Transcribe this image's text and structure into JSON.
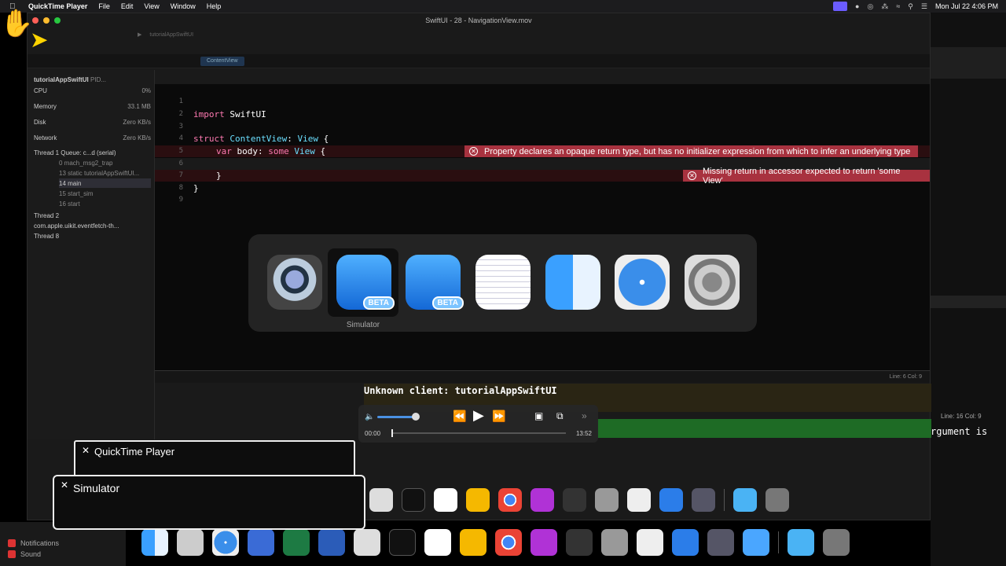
{
  "menubar": {
    "app": "QuickTime Player",
    "items": [
      "File",
      "Edit",
      "View",
      "Window",
      "Help"
    ],
    "clock": "Mon Jul 22  4:06 PM"
  },
  "window": {
    "title": "SwiftUI - 28 - NavigationView.mov",
    "scheme": "tutorialAppSwiftUI",
    "tab": "ContentView"
  },
  "navigator": {
    "process": "tutorialAppSwiftUI",
    "process_suffix": "PID...",
    "gauges": [
      {
        "label": "CPU",
        "value": "0%"
      },
      {
        "label": "Memory",
        "value": "33.1 MB"
      },
      {
        "label": "Disk",
        "value": "Zero KB/s"
      },
      {
        "label": "Network",
        "value": "Zero KB/s"
      }
    ],
    "threads": [
      "Thread 1  Queue: c...d (serial)",
      "0 mach_msg2_trap",
      "13 static tutorialAppSwiftUI...",
      "14 main",
      "15 start_sim",
      "16 start",
      "Thread 2",
      "com.apple.uikit.eventfetch-th...",
      "Thread 8"
    ]
  },
  "code": {
    "lines": [
      "1",
      "2",
      "3",
      "4",
      "5",
      "6",
      "7",
      "8",
      "9"
    ],
    "import_kw": "import",
    "import_mod": "SwiftUI",
    "struct_kw": "struct",
    "struct_name": "ContentView",
    "colon_view": ": ",
    "view_type": "View",
    "brace": " {",
    "var_kw": "var",
    "body_name": "body",
    "some_kw": "some",
    "close_inner": "}",
    "close_outer": "}"
  },
  "errors": [
    "Property declares an opaque return type, but has no initializer expression from which to infer an underlying type",
    "Missing return in accessor expected to return 'some View'"
  ],
  "switcher": {
    "selected_label": "Simulator",
    "beta": "BETA"
  },
  "debug": {
    "line_col": "Line: 6  Col: 9",
    "console_message": "Unknown client: tutorialAppSwiftUI",
    "right_line_col": "Line: 16  Col: 9",
    "right_console": "rgument is"
  },
  "player": {
    "current_time": "00:00",
    "duration": "13:52",
    "progress_fraction": 0.0
  },
  "popups": {
    "first": "QuickTime Player",
    "second": "Simulator"
  },
  "desktop_sidebar": {
    "items": [
      "Notifications",
      "Sound"
    ]
  },
  "colors": {
    "error_red": "#a8323f",
    "keyword_pink": "#ff7ab2",
    "type_cyan": "#6bdfff",
    "menu_accent": "#6b5cff"
  }
}
